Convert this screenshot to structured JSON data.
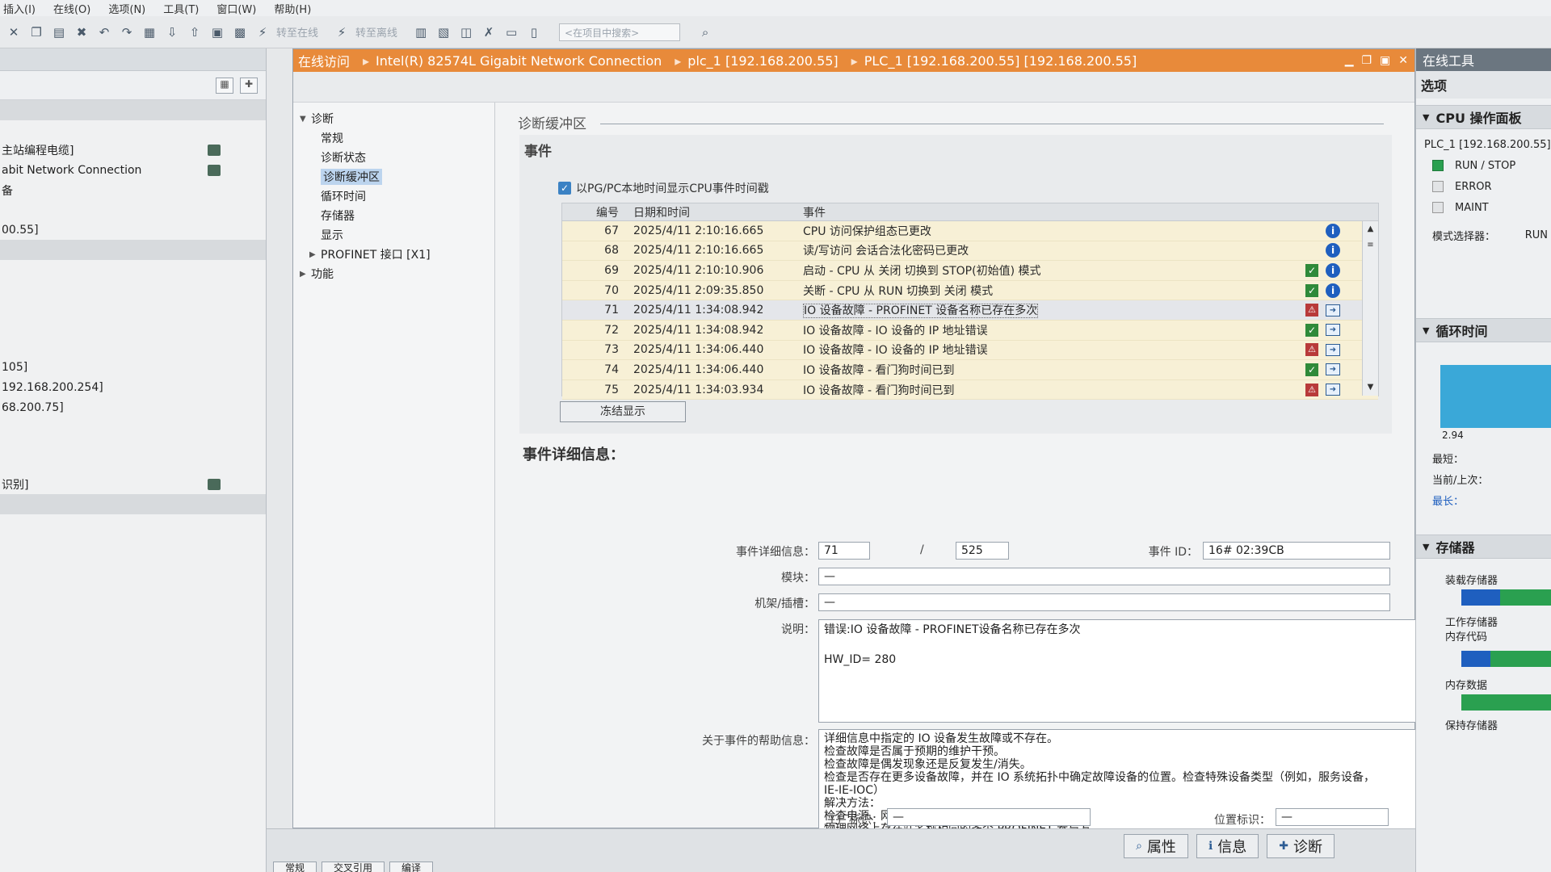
{
  "menubar": [
    "插入(I)",
    "在线(O)",
    "选项(N)",
    "工具(T)",
    "窗口(W)",
    "帮助(H)"
  ],
  "toolbar": {
    "go_online": "转至在线",
    "go_offline": "转至离线",
    "search_placeholder": "<在项目中搜索>"
  },
  "left_panel": {
    "items": [
      {
        "text": "主站编程电缆]",
        "icon": true
      },
      {
        "text": "abit Network Connection",
        "icon": true
      },
      {
        "text": "备",
        "icon": false
      },
      {
        "text": "00.55]",
        "icon": false
      },
      {
        "text": "105]",
        "icon": false
      },
      {
        "text": "192.168.200.254]",
        "icon": false
      },
      {
        "text": "68.200.75]",
        "icon": false
      },
      {
        "text": "识别]",
        "icon": true
      }
    ]
  },
  "editor": {
    "breadcrumb": [
      "在线访问",
      "Intel(R) 82574L Gigabit Network Connection",
      "plc_1 [192.168.200.55]",
      "PLC_1 [192.168.200.55] [192.168.200.55]"
    ]
  },
  "tree": {
    "root": "诊断",
    "items": [
      "常规",
      "诊断状态",
      "诊断缓冲区",
      "循环时间",
      "存储器",
      "显示"
    ],
    "profinet": "PROFINET 接口 [X1]",
    "functions": "功能"
  },
  "diag": {
    "section_title": "诊断缓冲区",
    "events_title": "事件",
    "checkbox_label": "以PG/PC本地时间显示CPU事件时间戳",
    "columns": {
      "no": "编号",
      "datetime": "日期和时间",
      "event": "事件"
    },
    "rows": [
      {
        "no": "67",
        "datetime": "2025/4/11 2:10:16.665",
        "event": "CPU 访问保护组态已更改",
        "status": "",
        "info": "i"
      },
      {
        "no": "68",
        "datetime": "2025/4/11 2:10:16.665",
        "event": "读/写访问 会话合法化密码已更改",
        "status": "",
        "info": "i"
      },
      {
        "no": "69",
        "datetime": "2025/4/11 2:10:10.906",
        "event": "启动 - CPU 从 关闭 切换到 STOP(初始值) 模式",
        "status": "ok",
        "info": "i"
      },
      {
        "no": "70",
        "datetime": "2025/4/11 2:09:35.850",
        "event": "关断 - CPU 从 RUN 切换到 关闭 模式",
        "status": "ok",
        "info": "i"
      },
      {
        "no": "71",
        "datetime": "2025/4/11 1:34:08.942",
        "event": "IO 设备故障 - PROFINET 设备名称已存在多次",
        "status": "err",
        "info": "go"
      },
      {
        "no": "72",
        "datetime": "2025/4/11 1:34:08.942",
        "event": "IO 设备故障 - IO 设备的 IP 地址错误",
        "status": "ok",
        "info": "go"
      },
      {
        "no": "73",
        "datetime": "2025/4/11 1:34:06.440",
        "event": "IO 设备故障 - IO 设备的 IP 地址错误",
        "status": "err",
        "info": "go"
      },
      {
        "no": "74",
        "datetime": "2025/4/11 1:34:06.440",
        "event": "IO 设备故障 - 看门狗时间已到",
        "status": "ok",
        "info": "go"
      },
      {
        "no": "75",
        "datetime": "2025/4/11 1:34:03.934",
        "event": "IO 设备故障 - 看门狗时间已到",
        "status": "err",
        "info": "go"
      }
    ],
    "freeze_button": "冻结显示",
    "details_title": "事件详细信息：",
    "details": {
      "detail_label": "事件详细信息：",
      "detail_value": "71",
      "slash": "/",
      "detail_total": "525",
      "event_id_label": "事件 ID：",
      "event_id_value": "16# 02:39CB",
      "module_label": "模块：",
      "module_value": "—",
      "rack_label": "机架/插槽：",
      "rack_value": "—",
      "desc_label": "说明：",
      "desc_line1": "错误:IO 设备故障 - PROFINET设备名称已存在多次",
      "desc_line2": "HW_ID=  280",
      "help_label": "关于事件的帮助信息：",
      "help_lines": [
        "详细信息中指定的 IO 设备发生故障或不存在。",
        "检查故障是否属于预期的维护干预。",
        "检查故障是偶发现象还是反复发生/消失。",
        "检查是否存在更多设备故障，并在 IO 系统拓扑中确定故障设备的位置。检查特殊设备类型（例如，服务设备，",
        "IE-IE-IOC）",
        "解决方法：",
        "检查电源、网络接线和连接器。",
        "物理网络上存在站名称相同的多个 PROFINET 参与方。"
      ],
      "plant_label": "工厂标识：",
      "plant_value": "—",
      "location_label": "位置标识：",
      "location_value": "—"
    }
  },
  "right_panel": {
    "title": "在线工具",
    "options": "选项",
    "cpu_panel": "CPU 操作面板",
    "plc_name": "PLC_1 [192.168.200.55]",
    "run_stop": "RUN / STOP",
    "error": "ERROR",
    "maint": "MAINT",
    "mode_selector": "模式选择器：",
    "mode_value": "RUN",
    "cycle_time": "循环时间",
    "cycle_value": "2.94",
    "shortest": "最短：",
    "current_last": "当前/上次：",
    "longest": "最长：",
    "memory": "存储器",
    "load_memory": "装载存储器",
    "work_memory_line1": "工作存储器",
    "work_memory_line2": "内存代码",
    "work_data": "内存数据",
    "retain_memory": "保持存储器"
  },
  "bottom": {
    "tabs": [
      "属性",
      "信息",
      "诊断"
    ],
    "subtabs": [
      "常规",
      "交叉引用",
      "编译"
    ]
  },
  "colors": {
    "title_orange": "#e88a3a",
    "run_green": "#2aa050",
    "error_red": "#b83a3a",
    "info_blue": "#1f5fbf"
  }
}
